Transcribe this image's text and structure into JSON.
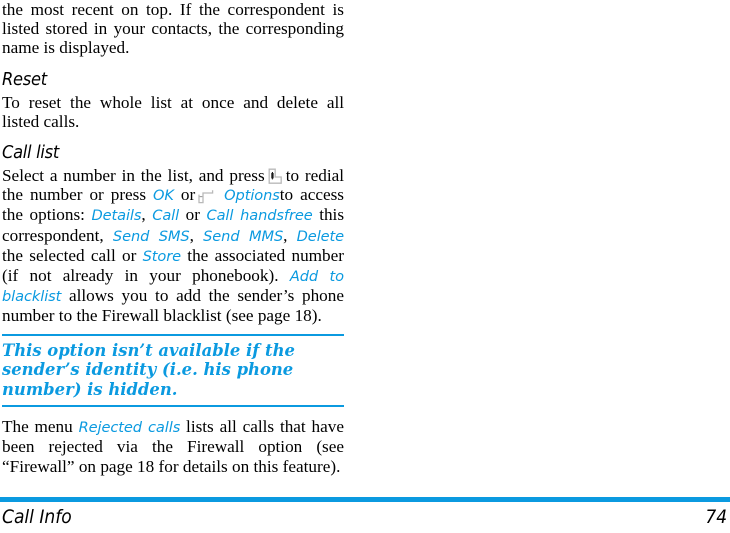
{
  "page": {
    "number": "74",
    "footer_title": "Call Info",
    "accent_color": "#0b9ae0",
    "text_color": "#000000",
    "background_color": "#ffffff"
  },
  "intro": {
    "text": "the most recent on top. If the correspondent is listed stored in your contacts, the corresponding name is displayed."
  },
  "sections": [
    {
      "heading": "Reset",
      "body": "To reset the whole list at once and delete all listed calls."
    },
    {
      "heading": "Call list"
    }
  ],
  "call_list": {
    "run1": "Select a number in the list, and press",
    "icon_call": "call-key-icon",
    "run2": "to redial the number or press",
    "term_ok": "OK",
    "run3": "or",
    "icon_softkey": "left-soft-key-icon",
    "term_options": "Options",
    "run4": "to access the options:",
    "term_details": "Details",
    "sep1": ",",
    "term_call": "Call",
    "run5": "or",
    "term_call_handsfree": "Call handsfree",
    "run6": "this correspondent,",
    "term_send_sms": "Send SMS",
    "sep2": ",",
    "term_send_mms": "Send MMS",
    "sep3": ",",
    "term_delete": "Delete",
    "run7": "the selected call or",
    "term_store": "Store",
    "run8": "the associated number (if not already in your phonebook).",
    "term_add_to_blacklist": "Add to blacklist",
    "run9": "allows you to add the sender’s phone number to the Firewall blacklist (see page 18)."
  },
  "note": {
    "text": "This option isn’t available if the sender’s identity (i.e. his phone number) is hidden."
  },
  "rejected": {
    "run1": "The menu",
    "term_rejected_calls": "Rejected calls",
    "run2": "lists all calls that have been rejected via the Firewall option (see “Firewall” on page 18 for details on this feature)."
  }
}
